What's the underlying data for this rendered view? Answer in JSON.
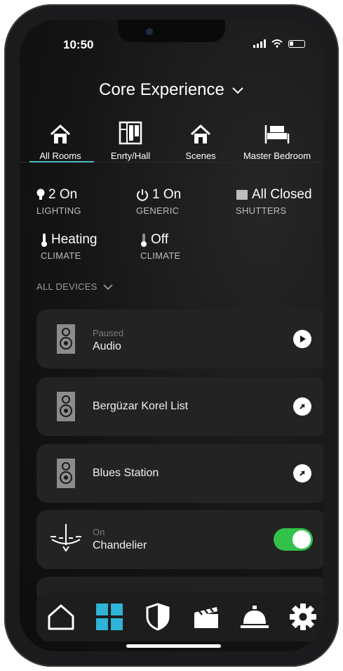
{
  "status": {
    "time": "10:50"
  },
  "header": {
    "title": "Core Experience"
  },
  "rooms": [
    {
      "label": "All Rooms",
      "icon": "home-icon",
      "active": true
    },
    {
      "label": "Enrty/Hall",
      "icon": "wardrobe-icon"
    },
    {
      "label": "Scenes",
      "icon": "home-icon"
    },
    {
      "label": "Master Bedroom",
      "icon": "bed-icon"
    }
  ],
  "stats": [
    {
      "value": "2 On",
      "label": "LIGHTING",
      "icon": "bulb-icon"
    },
    {
      "value": "1 On",
      "label": "GENERIC",
      "icon": "power-icon"
    },
    {
      "value": "All Closed",
      "label": "SHUTTERS",
      "icon": "shutter-icon"
    },
    {
      "value": "Heating",
      "label": "CLIMATE",
      "icon": "thermometer-icon"
    },
    {
      "value": "Off",
      "label": "CLIMATE",
      "icon": "thermometer-icon"
    }
  ],
  "devices_header": "ALL DEVICES",
  "devices": [
    {
      "sub": "Paused",
      "name": "Audio",
      "icon": "speaker-icon",
      "action": "play-icon"
    },
    {
      "sub": "",
      "name": "Bergüzar Korel List",
      "icon": "speaker-icon",
      "action": "open-arrow-icon"
    },
    {
      "sub": "",
      "name": "Blues Station",
      "icon": "speaker-icon",
      "action": "open-arrow-icon"
    },
    {
      "sub": "On",
      "name": "Chandelier",
      "icon": "chandelier-icon",
      "toggle_on": true
    }
  ],
  "dock": [
    "home-icon",
    "grid-icon",
    "shield-icon",
    "clapperboard-icon",
    "service-bell-icon",
    "gear-icon"
  ],
  "colors": {
    "accent": "#4fb7c9",
    "toggle_on": "#32c24b",
    "card": "#232323",
    "background": "#141414"
  }
}
